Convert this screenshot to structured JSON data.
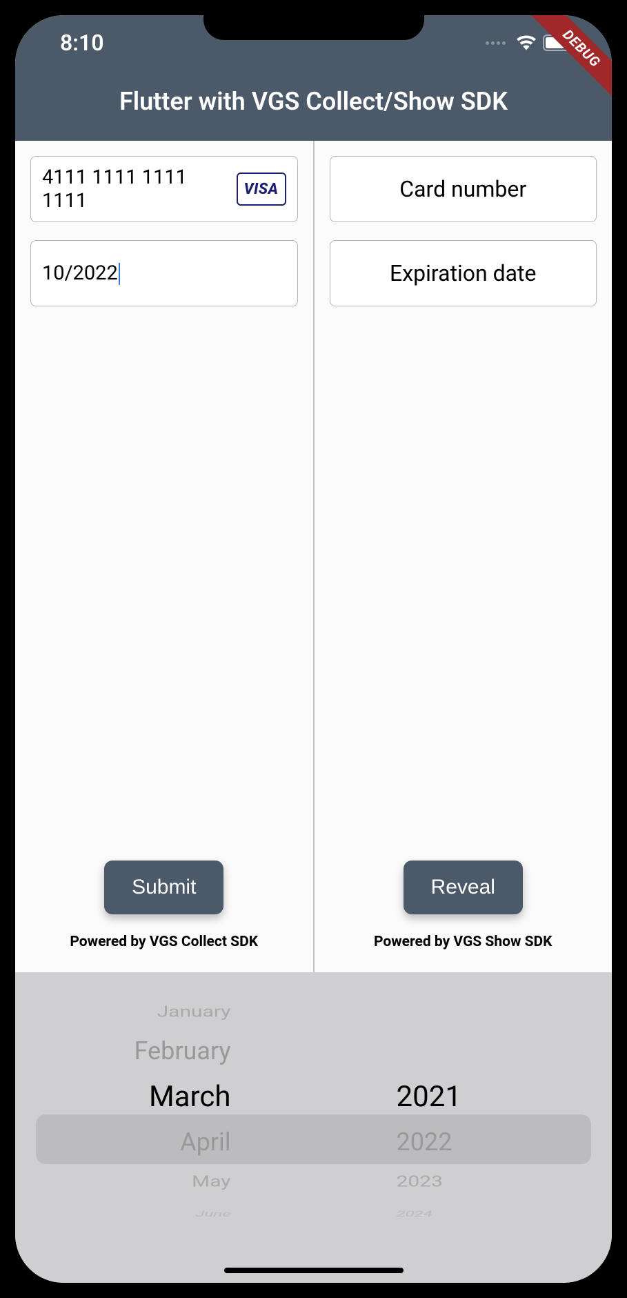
{
  "status": {
    "time": "8:10"
  },
  "debug_label": "DEBUG",
  "app_title": "Flutter with VGS Collect/Show SDK",
  "collect": {
    "card_number": "4111 1111 1111 1111",
    "card_brand": "VISA",
    "exp_date": "10/2022",
    "submit_label": "Submit",
    "footer": "Powered by VGS Collect SDK"
  },
  "show": {
    "card_placeholder": "Card number",
    "exp_placeholder": "Expiration date",
    "reveal_label": "Reveal",
    "footer": "Powered by VGS Show SDK"
  },
  "picker": {
    "months": [
      "January",
      "February",
      "March",
      "April",
      "May",
      "June"
    ],
    "selected_month": "March",
    "years": [
      "2021",
      "2022",
      "2023",
      "2024"
    ],
    "selected_year": "2021"
  }
}
